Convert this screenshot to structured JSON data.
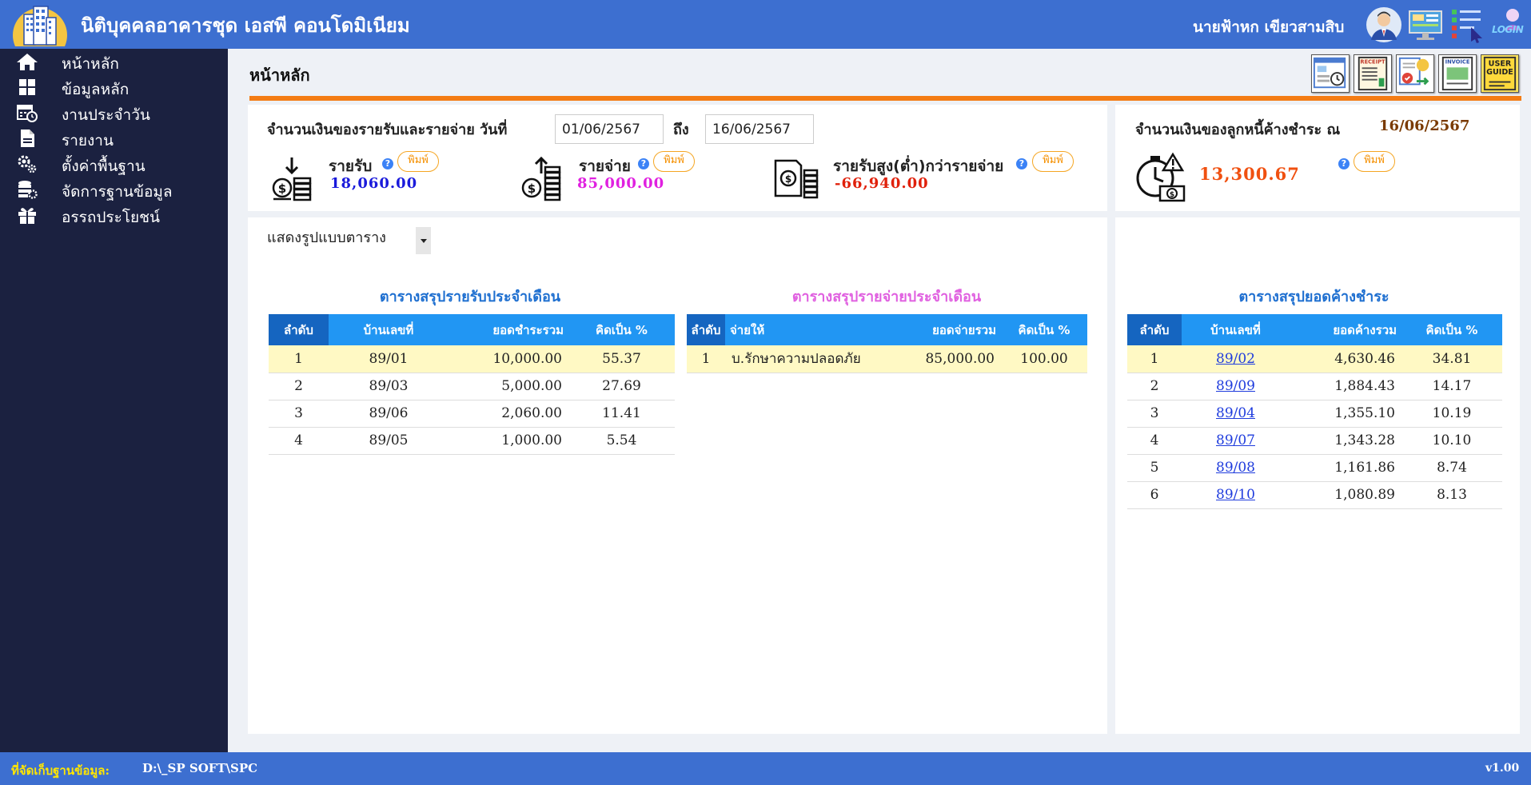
{
  "header": {
    "app_title": "นิติบุคคลอาคารชุด เอสพี คอนโดมิเนียม",
    "user_name": "นายฟ้าหก เขียวสามสิบ",
    "login_label": "LOGIN"
  },
  "sidebar": {
    "items": [
      {
        "label": "หน้าหลัก",
        "icon": "home-icon"
      },
      {
        "label": "ข้อมูลหลัก",
        "icon": "grid-icon"
      },
      {
        "label": "งานประจำวัน",
        "icon": "calendar-clock-icon"
      },
      {
        "label": "รายงาน",
        "icon": "document-icon"
      },
      {
        "label": "ตั้งค่าพื้นฐาน",
        "icon": "gears-icon"
      },
      {
        "label": "จัดการฐานข้อมูล",
        "icon": "database-gear-icon"
      },
      {
        "label": "อรรถประโยชน์",
        "icon": "gift-icon"
      }
    ]
  },
  "page": {
    "title": "หน้าหลัก",
    "tools": [
      "dashboard-icon",
      "receipt-icon",
      "payment-icon",
      "invoice-icon",
      "user-guide-icon"
    ],
    "receipt_text": "RECEIPT",
    "invoice_text": "INVOICE",
    "guide_text": "USER GUIDE"
  },
  "summary": {
    "title": "จำนวนเงินของรายรับและรายจ่าย วันที่",
    "date_from": "01/06/2567",
    "to_label": "ถึง",
    "date_to": "16/06/2567",
    "income_label": "รายรับ",
    "income_value": "18,060.00",
    "expense_label": "รายจ่าย",
    "expense_value": "85,000.00",
    "net_label": "รายรับสูง(ต่ำ)กว่ารายจ่าย",
    "net_value": "-66,940.00",
    "print_label": "พิมพ์",
    "help_glyph": "?"
  },
  "debt": {
    "title": "จำนวนเงินของลูกหนี้ค้างชำระ ณ",
    "date": "16/06/2567",
    "value": "13,300.67",
    "print_label": "พิมพ์"
  },
  "view": {
    "mode_label": "แสดงรูปแบบตาราง"
  },
  "income_table": {
    "title": "ตารางสรุปรายรับประจำเดือน",
    "headers": [
      "ลำดับ",
      "บ้านเลขที่",
      "ยอดชำระรวม",
      "คิดเป็น %"
    ],
    "rows": [
      [
        "1",
        "89/01",
        "10,000.00",
        "55.37"
      ],
      [
        "2",
        "89/03",
        "5,000.00",
        "27.69"
      ],
      [
        "3",
        "89/06",
        "2,060.00",
        "11.41"
      ],
      [
        "4",
        "89/05",
        "1,000.00",
        "5.54"
      ]
    ]
  },
  "expense_table": {
    "title": "ตารางสรุปรายจ่ายประจำเดือน",
    "headers": [
      "ลำดับ",
      "จ่ายให้",
      "ยอดจ่ายรวม",
      "คิดเป็น %"
    ],
    "rows": [
      [
        "1",
        "บ.รักษาความปลอดภัย",
        "85,000.00",
        "100.00"
      ]
    ]
  },
  "debt_table": {
    "title": "ตารางสรุปยอดค้างชำระ",
    "headers": [
      "ลำดับ",
      "บ้านเลขที่",
      "ยอดค้างรวม",
      "คิดเป็น %"
    ],
    "rows": [
      [
        "1",
        "89/02",
        "4,630.46",
        "34.81"
      ],
      [
        "2",
        "89/09",
        "1,884.43",
        "14.17"
      ],
      [
        "3",
        "89/04",
        "1,355.10",
        "10.19"
      ],
      [
        "4",
        "89/07",
        "1,343.28",
        "10.10"
      ],
      [
        "5",
        "89/08",
        "1,161.86",
        "8.74"
      ],
      [
        "6",
        "89/10",
        "1,080.89",
        "8.13"
      ]
    ]
  },
  "footer": {
    "db_label": "ที่จัดเก็บฐานข้อมูล:",
    "db_path": "D:\\_SP SOFT\\SPC",
    "version": "v1.00"
  },
  "colors": {
    "topbar": "#3d6fd0",
    "sidebar": "#1b2140",
    "accent": "#f47c14",
    "income": "#1a1adb",
    "expense": "#e020e0",
    "negative": "#e0200a",
    "income_table_title": "#1e6fd0",
    "expense_table_title": "#e060e0",
    "debt_table_title": "#1e6fd0"
  }
}
